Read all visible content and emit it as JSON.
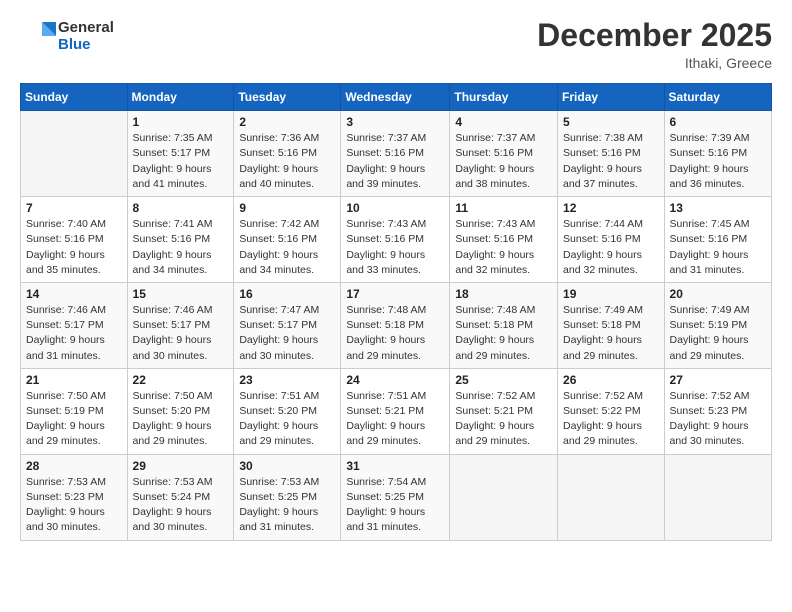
{
  "logo": {
    "text_general": "General",
    "text_blue": "Blue"
  },
  "header": {
    "month": "December 2025",
    "location": "Ithaki, Greece"
  },
  "days_of_week": [
    "Sunday",
    "Monday",
    "Tuesday",
    "Wednesday",
    "Thursday",
    "Friday",
    "Saturday"
  ],
  "weeks": [
    [
      {
        "day": "",
        "info": ""
      },
      {
        "day": "1",
        "info": "Sunrise: 7:35 AM\nSunset: 5:17 PM\nDaylight: 9 hours\nand 41 minutes."
      },
      {
        "day": "2",
        "info": "Sunrise: 7:36 AM\nSunset: 5:16 PM\nDaylight: 9 hours\nand 40 minutes."
      },
      {
        "day": "3",
        "info": "Sunrise: 7:37 AM\nSunset: 5:16 PM\nDaylight: 9 hours\nand 39 minutes."
      },
      {
        "day": "4",
        "info": "Sunrise: 7:37 AM\nSunset: 5:16 PM\nDaylight: 9 hours\nand 38 minutes."
      },
      {
        "day": "5",
        "info": "Sunrise: 7:38 AM\nSunset: 5:16 PM\nDaylight: 9 hours\nand 37 minutes."
      },
      {
        "day": "6",
        "info": "Sunrise: 7:39 AM\nSunset: 5:16 PM\nDaylight: 9 hours\nand 36 minutes."
      }
    ],
    [
      {
        "day": "7",
        "info": "Sunrise: 7:40 AM\nSunset: 5:16 PM\nDaylight: 9 hours\nand 35 minutes."
      },
      {
        "day": "8",
        "info": "Sunrise: 7:41 AM\nSunset: 5:16 PM\nDaylight: 9 hours\nand 34 minutes."
      },
      {
        "day": "9",
        "info": "Sunrise: 7:42 AM\nSunset: 5:16 PM\nDaylight: 9 hours\nand 34 minutes."
      },
      {
        "day": "10",
        "info": "Sunrise: 7:43 AM\nSunset: 5:16 PM\nDaylight: 9 hours\nand 33 minutes."
      },
      {
        "day": "11",
        "info": "Sunrise: 7:43 AM\nSunset: 5:16 PM\nDaylight: 9 hours\nand 32 minutes."
      },
      {
        "day": "12",
        "info": "Sunrise: 7:44 AM\nSunset: 5:16 PM\nDaylight: 9 hours\nand 32 minutes."
      },
      {
        "day": "13",
        "info": "Sunrise: 7:45 AM\nSunset: 5:16 PM\nDaylight: 9 hours\nand 31 minutes."
      }
    ],
    [
      {
        "day": "14",
        "info": "Sunrise: 7:46 AM\nSunset: 5:17 PM\nDaylight: 9 hours\nand 31 minutes."
      },
      {
        "day": "15",
        "info": "Sunrise: 7:46 AM\nSunset: 5:17 PM\nDaylight: 9 hours\nand 30 minutes."
      },
      {
        "day": "16",
        "info": "Sunrise: 7:47 AM\nSunset: 5:17 PM\nDaylight: 9 hours\nand 30 minutes."
      },
      {
        "day": "17",
        "info": "Sunrise: 7:48 AM\nSunset: 5:18 PM\nDaylight: 9 hours\nand 29 minutes."
      },
      {
        "day": "18",
        "info": "Sunrise: 7:48 AM\nSunset: 5:18 PM\nDaylight: 9 hours\nand 29 minutes."
      },
      {
        "day": "19",
        "info": "Sunrise: 7:49 AM\nSunset: 5:18 PM\nDaylight: 9 hours\nand 29 minutes."
      },
      {
        "day": "20",
        "info": "Sunrise: 7:49 AM\nSunset: 5:19 PM\nDaylight: 9 hours\nand 29 minutes."
      }
    ],
    [
      {
        "day": "21",
        "info": "Sunrise: 7:50 AM\nSunset: 5:19 PM\nDaylight: 9 hours\nand 29 minutes."
      },
      {
        "day": "22",
        "info": "Sunrise: 7:50 AM\nSunset: 5:20 PM\nDaylight: 9 hours\nand 29 minutes."
      },
      {
        "day": "23",
        "info": "Sunrise: 7:51 AM\nSunset: 5:20 PM\nDaylight: 9 hours\nand 29 minutes."
      },
      {
        "day": "24",
        "info": "Sunrise: 7:51 AM\nSunset: 5:21 PM\nDaylight: 9 hours\nand 29 minutes."
      },
      {
        "day": "25",
        "info": "Sunrise: 7:52 AM\nSunset: 5:21 PM\nDaylight: 9 hours\nand 29 minutes."
      },
      {
        "day": "26",
        "info": "Sunrise: 7:52 AM\nSunset: 5:22 PM\nDaylight: 9 hours\nand 29 minutes."
      },
      {
        "day": "27",
        "info": "Sunrise: 7:52 AM\nSunset: 5:23 PM\nDaylight: 9 hours\nand 30 minutes."
      }
    ],
    [
      {
        "day": "28",
        "info": "Sunrise: 7:53 AM\nSunset: 5:23 PM\nDaylight: 9 hours\nand 30 minutes."
      },
      {
        "day": "29",
        "info": "Sunrise: 7:53 AM\nSunset: 5:24 PM\nDaylight: 9 hours\nand 30 minutes."
      },
      {
        "day": "30",
        "info": "Sunrise: 7:53 AM\nSunset: 5:25 PM\nDaylight: 9 hours\nand 31 minutes."
      },
      {
        "day": "31",
        "info": "Sunrise: 7:54 AM\nSunset: 5:25 PM\nDaylight: 9 hours\nand 31 minutes."
      },
      {
        "day": "",
        "info": ""
      },
      {
        "day": "",
        "info": ""
      },
      {
        "day": "",
        "info": ""
      }
    ]
  ]
}
